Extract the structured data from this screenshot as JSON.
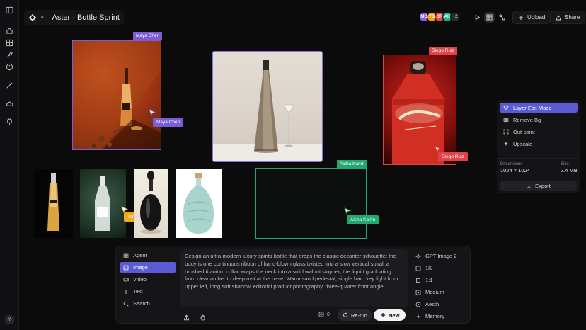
{
  "project": {
    "title": "Aster · Bottle Sprint",
    "rail_avatar": "Y"
  },
  "collaborators": [
    {
      "initials": "MC",
      "color": "#8b5cf6"
    },
    {
      "initials": "TB",
      "color": "#f59e0b"
    },
    {
      "initials": "DR",
      "color": "#ef4444"
    },
    {
      "initials": "AK",
      "color": "#10b981"
    },
    {
      "initials": "+2",
      "color": "#2a2a2e"
    }
  ],
  "toolbar": {
    "upload_label": "Upload",
    "share_label": "Share"
  },
  "canvas": {
    "labels": {
      "maya_frame": "Maya Chen",
      "maya_cursor": "Maya Chen",
      "diego_frame": "Diego Ruiz",
      "diego_cursor": "Diego Ruiz",
      "aisha_frame": "Aisha Karim",
      "aisha_cursor": "Aisha Karim",
      "tom_cursor": "Tom Becker"
    },
    "colors": {
      "maya": "#7c5cd6",
      "diego": "#e0434a",
      "aisha": "#1fa971",
      "tom": "#f5a623"
    }
  },
  "layer_menu": {
    "items": [
      {
        "label": "Layer Edit Mode",
        "icon": "layers-icon"
      },
      {
        "label": "Remove Bg",
        "icon": "camera-icon"
      },
      {
        "label": "Out-paint",
        "icon": "expand-icon"
      },
      {
        "label": "Upscale",
        "icon": "sparkle-icon"
      }
    ],
    "dimensions_label": "Dimensions",
    "dimensions_value": "1024 × 1024",
    "size_label": "Size",
    "size_value": "2.4 MB",
    "export_label": "Export"
  },
  "prompt_panel": {
    "modes": [
      {
        "label": "Agent",
        "icon": "agent-icon"
      },
      {
        "label": "Image",
        "icon": "image-icon"
      },
      {
        "label": "Video",
        "icon": "video-icon"
      },
      {
        "label": "Text",
        "icon": "text-icon"
      },
      {
        "label": "Search",
        "icon": "search-icon"
      }
    ],
    "active_mode": "Image",
    "prompt_text": "Design an ultra-modern luxury spirits bottle that drops the classic decanter silhouette: the body is one continuous ribbon of hand-blown glass twisted into a slow vertical spiral, a brushed titanium collar wraps the neck into a solid walnut stopper, the liquid graduating from clear amber to deep rust at the base. Warm sand pedestal, single hard key light from upper left, long soft shadow, editorial product photography, three-quarter front angle.",
    "credits": "0",
    "rerun_label": "Re-run",
    "new_label": "New",
    "settings": [
      {
        "label": "GPT Image 2",
        "icon": "model-icon"
      },
      {
        "label": "1K",
        "icon": "resolution-icon"
      },
      {
        "label": "1:1",
        "icon": "aspect-icon"
      },
      {
        "label": "Medium",
        "icon": "quality-icon"
      },
      {
        "label": "Aesth",
        "icon": "style-icon"
      },
      {
        "label": "Memory",
        "icon": "memory-icon"
      }
    ]
  }
}
